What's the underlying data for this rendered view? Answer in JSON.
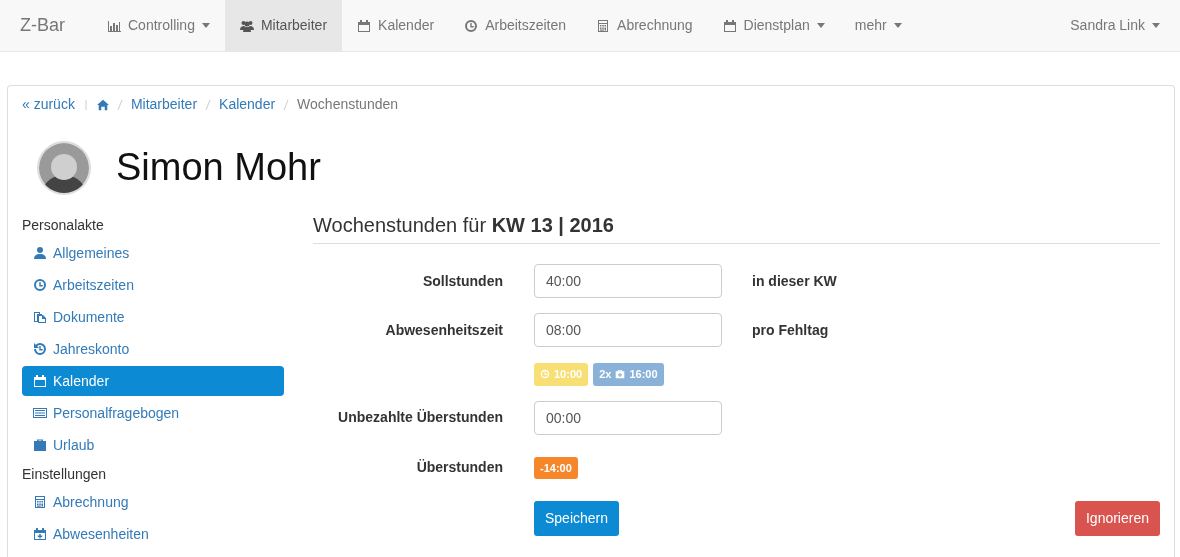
{
  "navbar": {
    "brand": "Z-Bar",
    "items": [
      {
        "label": "Controlling",
        "dropdown": true,
        "selected": false
      },
      {
        "label": "Mitarbeiter",
        "dropdown": false,
        "selected": true
      },
      {
        "label": "Kalender",
        "dropdown": false,
        "selected": false
      },
      {
        "label": "Arbeitszeiten",
        "dropdown": false,
        "selected": false
      },
      {
        "label": "Abrechnung",
        "dropdown": false,
        "selected": false
      },
      {
        "label": "Dienstplan",
        "dropdown": true,
        "selected": false
      },
      {
        "label": "mehr",
        "dropdown": true,
        "selected": false
      }
    ],
    "user": {
      "label": "Sandra Link",
      "dropdown": true
    }
  },
  "breadcrumb": {
    "back": "« zurück",
    "items": [
      "Mitarbeiter",
      "Kalender"
    ],
    "current": "Wochenstunden"
  },
  "profile": {
    "name": "Simon Mohr"
  },
  "sidebar": [
    {
      "title": "Personalakte",
      "items": [
        {
          "label": "Allgemeines",
          "selected": false
        },
        {
          "label": "Arbeitszeiten",
          "selected": false
        },
        {
          "label": "Dokumente",
          "selected": false
        },
        {
          "label": "Jahreskonto",
          "selected": false
        },
        {
          "label": "Kalender",
          "selected": true
        },
        {
          "label": "Personalfragebogen",
          "selected": false
        },
        {
          "label": "Urlaub",
          "selected": false
        }
      ]
    },
    {
      "title": "Einstellungen",
      "items": [
        {
          "label": "Abrechnung",
          "selected": false
        },
        {
          "label": "Abwesenheiten",
          "selected": false
        }
      ]
    }
  ],
  "form": {
    "title": "Wochenstunden für **KW 13 | 2016**",
    "rows": [
      {
        "kind": "input",
        "label": "Sollstunden",
        "value": "40:00",
        "suffix": "in dieser KW"
      },
      {
        "kind": "input",
        "label": "Abwesenheitszeit",
        "value": "08:00",
        "suffix": "pro Fehltag"
      },
      {
        "kind": "badges",
        "badges": [
          {
            "kind": "time",
            "text": "10:00",
            "color": "#f7df73"
          },
          {
            "kind": "sick",
            "count": "2x",
            "text": "16:00",
            "color": "#8ab2d9"
          }
        ]
      },
      {
        "kind": "input",
        "label": "Unbezahlte Überstunden",
        "value": "00:00"
      },
      {
        "kind": "badge",
        "label": "Überstunden",
        "value": "-14:00",
        "color": "#f5862a"
      }
    ],
    "buttons": [
      {
        "label": "Speichern",
        "kind": "primary"
      },
      {
        "label": "Ignorieren",
        "kind": "danger"
      }
    ]
  }
}
